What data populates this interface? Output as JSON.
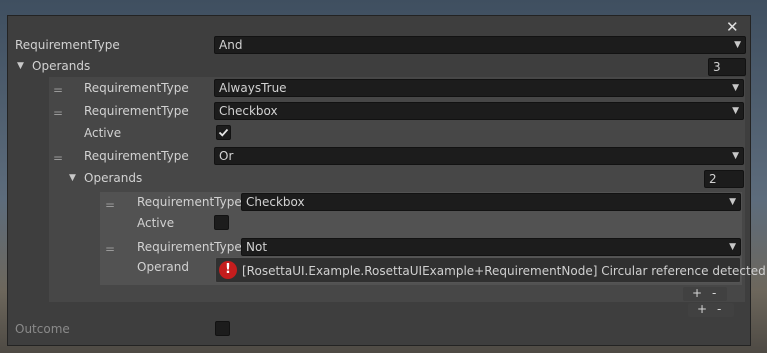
{
  "window": {
    "close_icon": "close-icon"
  },
  "root": {
    "requirement_type_label": "RequirementType",
    "requirement_type_value": "And",
    "operands_label": "Operands",
    "operands_count": "3"
  },
  "items": {
    "item0": {
      "label": "RequirementType",
      "value": "AlwaysTrue"
    },
    "item1": {
      "label": "RequirementType",
      "value": "Checkbox",
      "active_label": "Active",
      "active_checked": true
    },
    "item2": {
      "label": "RequirementType",
      "value": "Or",
      "operands_label": "Operands",
      "operands_count": "2",
      "sub0": {
        "label": "RequirementType",
        "value": "Checkbox",
        "active_label": "Active",
        "active_checked": false
      },
      "sub1": {
        "label": "RequirementType",
        "value": "Not",
        "operand_label": "Operand",
        "error_message": "[RosettaUI.Example.RosettaUIExample+RequirementNode] Circular reference detected."
      }
    }
  },
  "list_buttons": {
    "plus": "+",
    "minus": "-"
  },
  "handle_glyph": "=",
  "outcome": {
    "label": "Outcome",
    "checked": false
  },
  "icons": {
    "dropdown": "dropdown-arrow-icon",
    "foldout": "foldout-triangle-icon",
    "error": "error-icon"
  },
  "colors": {
    "window_bg": "#3e3e3e",
    "field_bg": "#1c1c1c",
    "error_red": "#c41d1d"
  }
}
